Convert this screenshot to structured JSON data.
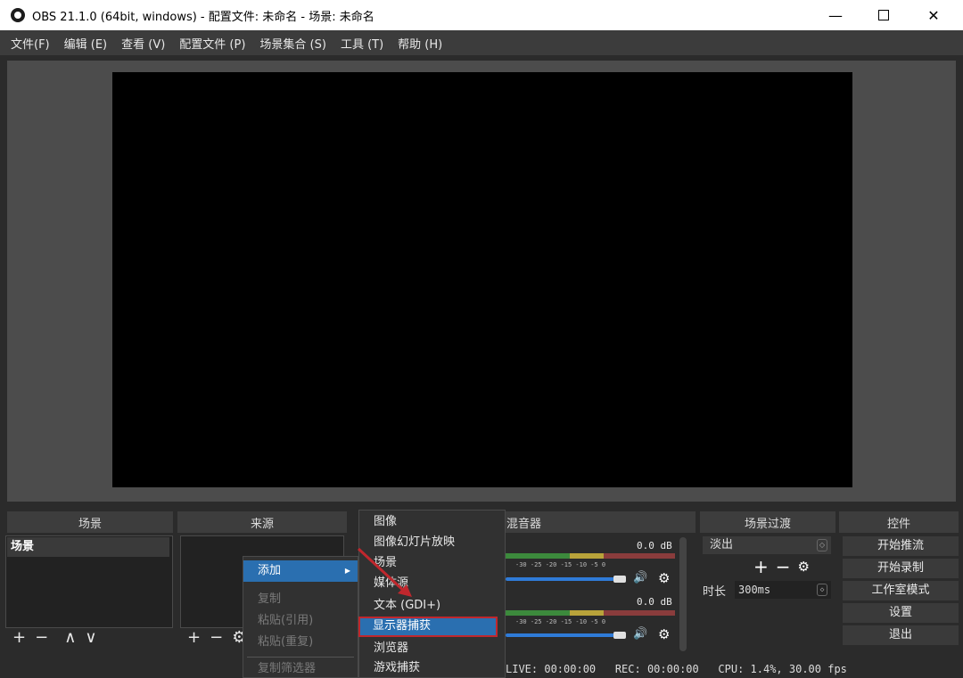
{
  "window": {
    "title": "OBS 21.1.0 (64bit, windows) - 配置文件: 未命名 - 场景: 未命名",
    "min_glyph": "—",
    "close_glyph": "✕"
  },
  "menubar": {
    "items": [
      "文件(F)",
      "编辑 (E)",
      "查看 (V)",
      "配置文件 (P)",
      "场景集合 (S)",
      "工具 (T)",
      "帮助 (H)"
    ]
  },
  "docks": {
    "scenes_title": "场景",
    "sources_title": "来源",
    "mixer_title": "混音器",
    "transitions_title": "场景过渡",
    "controls_title": "控件"
  },
  "scenes": {
    "items": [
      "场景"
    ],
    "toolbar": [
      "+",
      "−",
      "∧",
      "∨"
    ]
  },
  "sources": {
    "toolbar": [
      "+",
      "−",
      "⚙"
    ]
  },
  "mixer": {
    "channels": [
      {
        "db": "0.0 dB",
        "ticks": "-30  -25  -20  -15  -10   -5   0"
      },
      {
        "db": "0.0 dB",
        "ticks": "-30  -25  -20  -15  -10   -5   0"
      }
    ],
    "speaker_glyph": "🔊",
    "gear_glyph": "⚙"
  },
  "transitions": {
    "selected": "淡出",
    "duration_label": "时长",
    "duration_value": "300ms",
    "tools": [
      "+",
      "−",
      "⚙"
    ]
  },
  "controls": {
    "buttons": [
      "开始推流",
      "开始录制",
      "工作室模式",
      "设置",
      "退出"
    ]
  },
  "status": {
    "text": "LIVE: 00:00:00   REC: 00:00:00   CPU: 1.4%, 30.00 fps"
  },
  "context_menu": {
    "items": [
      {
        "label": "添加",
        "state": "active",
        "has_submenu": true
      },
      {
        "label": "复制",
        "state": "disabled"
      },
      {
        "label": "粘贴(引用)",
        "state": "disabled"
      },
      {
        "label": "粘贴(重复)",
        "state": "disabled"
      },
      {
        "label": "复制筛选器",
        "state": "disabled"
      }
    ]
  },
  "add_submenu": {
    "items": [
      "图像",
      "图像幻灯片放映",
      "场景",
      "媒体源",
      "文本 (GDI+)",
      "显示器捕获",
      "浏览器",
      "游戏捕获"
    ],
    "highlighted": "显示器捕获"
  },
  "colors": {
    "accent": "#2a6fb0",
    "annotation_red": "#c0272d"
  }
}
